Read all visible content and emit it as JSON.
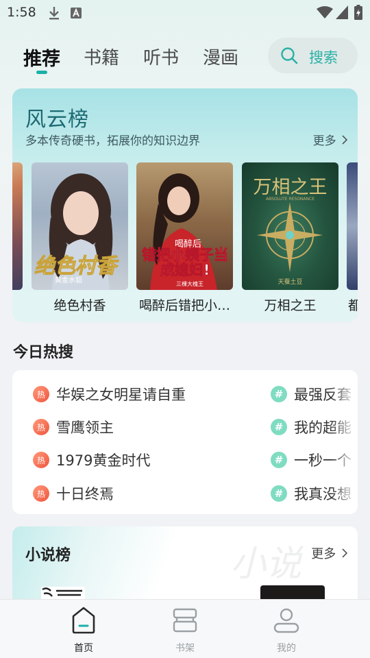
{
  "status_bar": {
    "time": "1:58"
  },
  "tabs": [
    {
      "label": "推荐",
      "active": true
    },
    {
      "label": "书籍"
    },
    {
      "label": "听书"
    },
    {
      "label": "漫画"
    }
  ],
  "search": {
    "label": "搜索"
  },
  "rank": {
    "title": "风云榜",
    "subtitle": "多本传奇硬书，拓展你的知识边界",
    "more": "更多",
    "books": [
      {
        "title": "绝色村香",
        "cover_text": "绝色村香",
        "cover_sub": "黄金水貂"
      },
      {
        "title": "喝醉后错把小…",
        "cover_text": "错把小姨子当成媳妇!",
        "cover_top": "喝醉后",
        "cover_sub": "三棵大槐王"
      },
      {
        "title": "万相之王",
        "cover_text": "万相之王",
        "cover_sub": "天蚕土豆",
        "cover_top": "ABSOLUTE RESONANCE"
      },
      {
        "title": "都"
      }
    ]
  },
  "hot_search": {
    "heading": "今日热搜",
    "left": [
      {
        "badge": "热",
        "text": "华娱之女明星请自重"
      },
      {
        "badge": "热",
        "text": "雪鹰领主"
      },
      {
        "badge": "热",
        "text": "1979黄金时代"
      },
      {
        "badge": "热",
        "text": "十日终焉"
      }
    ],
    "right": [
      {
        "badge": "#",
        "text": "最强反套"
      },
      {
        "badge": "#",
        "text": "我的超能"
      },
      {
        "badge": "#",
        "text": "一秒一个"
      },
      {
        "badge": "#",
        "text": "我真没想"
      }
    ]
  },
  "novel_rank": {
    "title": "小说榜",
    "more": "更多",
    "watermark": "小说"
  },
  "bottom_nav": [
    {
      "label": "首页",
      "active": true,
      "icon": "home-icon"
    },
    {
      "label": "书架",
      "icon": "bookshelf-icon"
    },
    {
      "label": "我的",
      "icon": "profile-icon"
    }
  ],
  "colors": {
    "accent": "#19b1a8",
    "hot_badge": "#f0543d",
    "tag_badge": "#7fdcc0",
    "rank_title": "#1e6a73"
  }
}
